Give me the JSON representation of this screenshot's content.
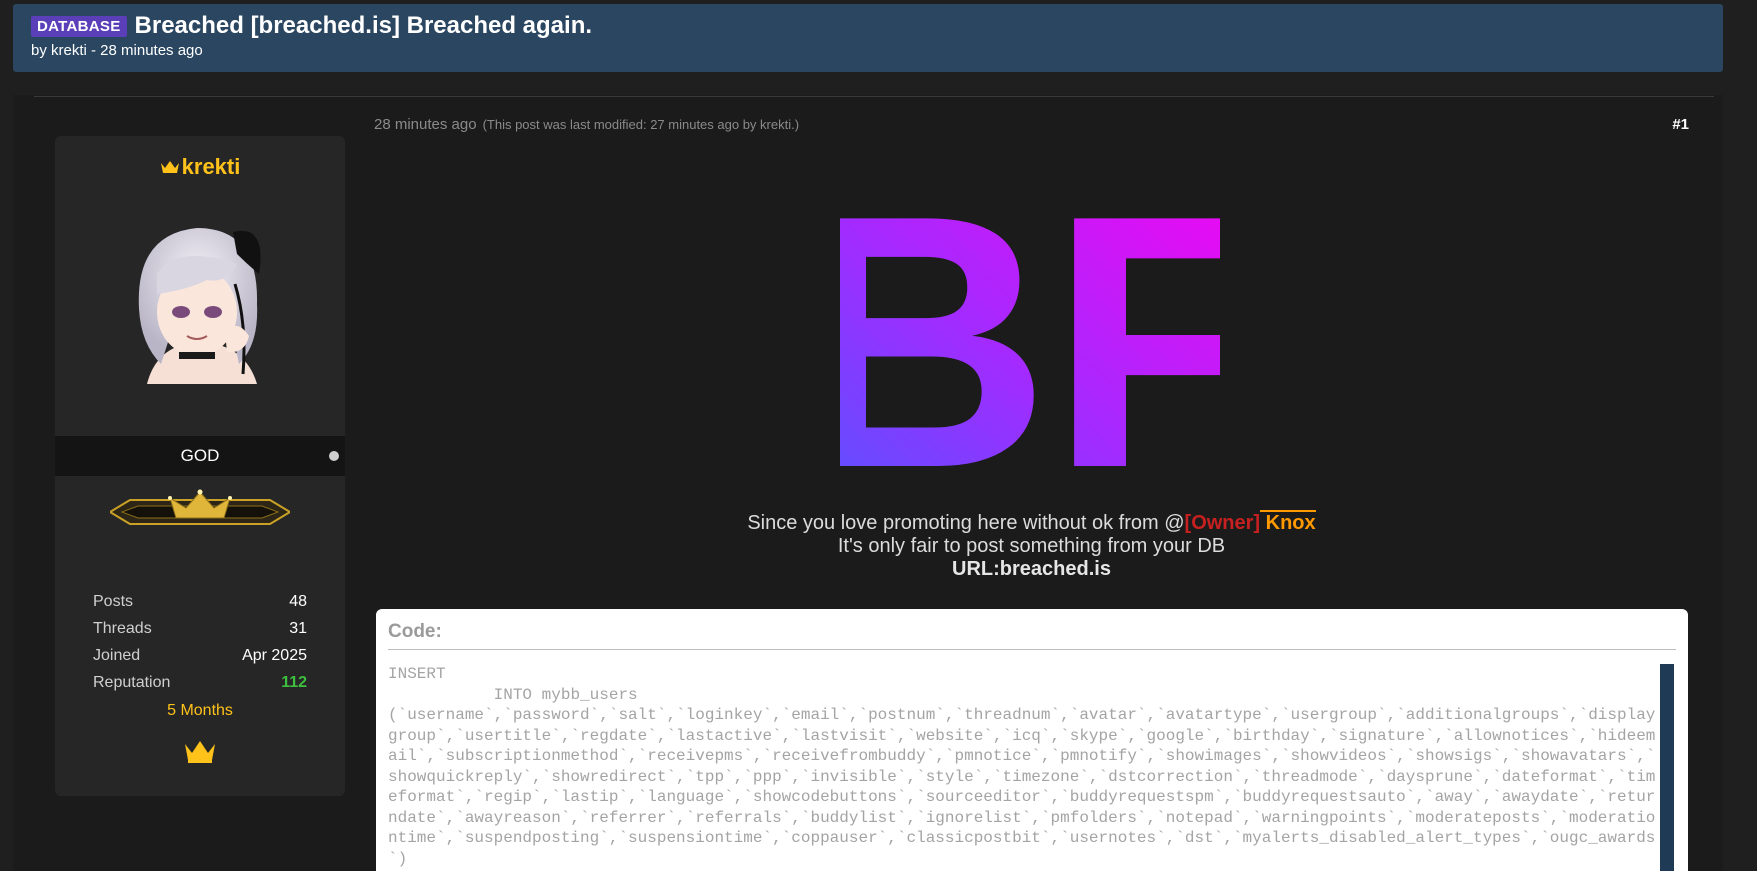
{
  "header": {
    "prefix": "DATABASE",
    "title": "Breached [breached.is] Breached again.",
    "byline": "by krekti - 28 minutes ago"
  },
  "author": {
    "username": "krekti",
    "rank": "GOD",
    "stats": [
      {
        "label": "Posts",
        "value": "48"
      },
      {
        "label": "Threads",
        "value": "31"
      },
      {
        "label": "Joined",
        "value": "Apr 2025"
      },
      {
        "label": "Reputation",
        "value": "112"
      }
    ],
    "tenure": "5 Months",
    "icons": {
      "username": "crown-icon",
      "award": "crown-icon"
    }
  },
  "post": {
    "time": "28 minutes ago",
    "modified": "(This post was last modified: 27 minutes ago by krekti.)",
    "number": "#1",
    "logo_text": "BF",
    "message": {
      "line1_prefix": "Since you love promoting here without ok from @",
      "owner_tag": "[Owner]",
      "owner_name": " Knox",
      "line2": "It's only fair to post something from your DB",
      "line3": "URL:breached.is"
    },
    "code": {
      "label": "Code:",
      "content": "INSERT\n           INTO mybb_users\n(`username`,`password`,`salt`,`loginkey`,`email`,`postnum`,`threadnum`,`avatar`,`avatartype`,`usergroup`,`additionalgroups`,`displaygroup`,`usertitle`,`regdate`,`lastactive`,`lastvisit`,`website`,`icq`,`skype`,`google`,`birthday`,`signature`,`allownotices`,`hideemail`,`subscriptionmethod`,`receivepms`,`receivefrombuddy`,`pmnotice`,`pmnotify`,`showimages`,`showvideos`,`showsigs`,`showavatars`,`showquickreply`,`showredirect`,`tpp`,`ppp`,`invisible`,`style`,`timezone`,`dstcorrection`,`threadmode`,`daysprune`,`dateformat`,`timeformat`,`regip`,`lastip`,`language`,`showcodebuttons`,`sourceeditor`,`buddyrequestspm`,`buddyrequestsauto`,`away`,`awaydate`,`returndate`,`awayreason`,`referrer`,`referrals`,`buddylist`,`ignorelist`,`pmfolders`,`notepad`,`warningpoints`,`moderateposts`,`moderationtime`,`suspendposting`,`suspensiontime`,`coppauser`,`classicpostbit`,`usernotes`,`dst`,`myalerts_disabled_alert_types`,`ougc_awards`)"
    }
  },
  "colors": {
    "header_bg": "#2a4660",
    "prefix_bg": "#5a3fb8",
    "username": "#ffc21a",
    "reputation": "#3fbf3f",
    "owner_tag": "#c62020",
    "owner_name": "#ff9900"
  }
}
